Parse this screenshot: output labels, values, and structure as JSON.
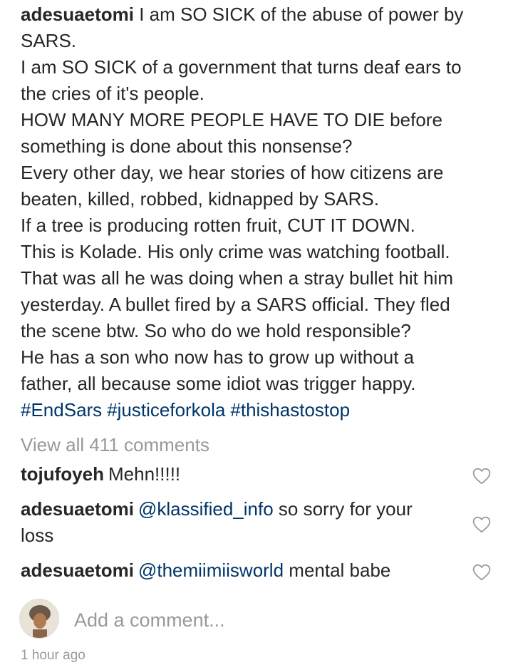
{
  "post": {
    "username": "adesuaetomi",
    "caption_lines": [
      "I am SO SICK of the abuse of power by",
      "SARS.",
      "I am SO SICK of a government that turns deaf ears to",
      "the cries of it's people.",
      "HOW MANY MORE PEOPLE HAVE TO DIE before",
      "something is done about this nonsense?",
      "Every other day, we hear stories of how citizens are",
      "beaten, killed, robbed, kidnapped by SARS.",
      "If a tree is producing rotten fruit, CUT IT DOWN.",
      "This is Kolade. His only crime was watching football.",
      "That was all he was doing when a stray bullet hit him",
      "yesterday. A bullet fired by a SARS official. They fled",
      "the scene btw. So who do we hold responsible?",
      "He has a son who now has to grow up without a",
      "father, all because some idiot was trigger happy."
    ],
    "hashtags": [
      "#EndSars",
      "#justiceforkola",
      "#thishastostop"
    ],
    "view_all_comments": "View all 411 comments",
    "timestamp": "1 hour ago"
  },
  "comments": [
    {
      "username": "tojufoyeh",
      "mention": "",
      "text": "Mehn!!!!!",
      "text_line2": ""
    },
    {
      "username": "adesuaetomi",
      "mention": "@klassified_info",
      "text": "so sorry for your",
      "text_line2": "loss"
    },
    {
      "username": "adesuaetomi",
      "mention": "@themiimiisworld",
      "text": "mental babe",
      "text_line2": ""
    }
  ],
  "add_comment": {
    "placeholder": "Add a comment..."
  },
  "icons": {
    "like": "heart-outline-icon",
    "avatar": "user-avatar"
  },
  "colors": {
    "text": "#262626",
    "link": "#003569",
    "muted": "#999999"
  }
}
